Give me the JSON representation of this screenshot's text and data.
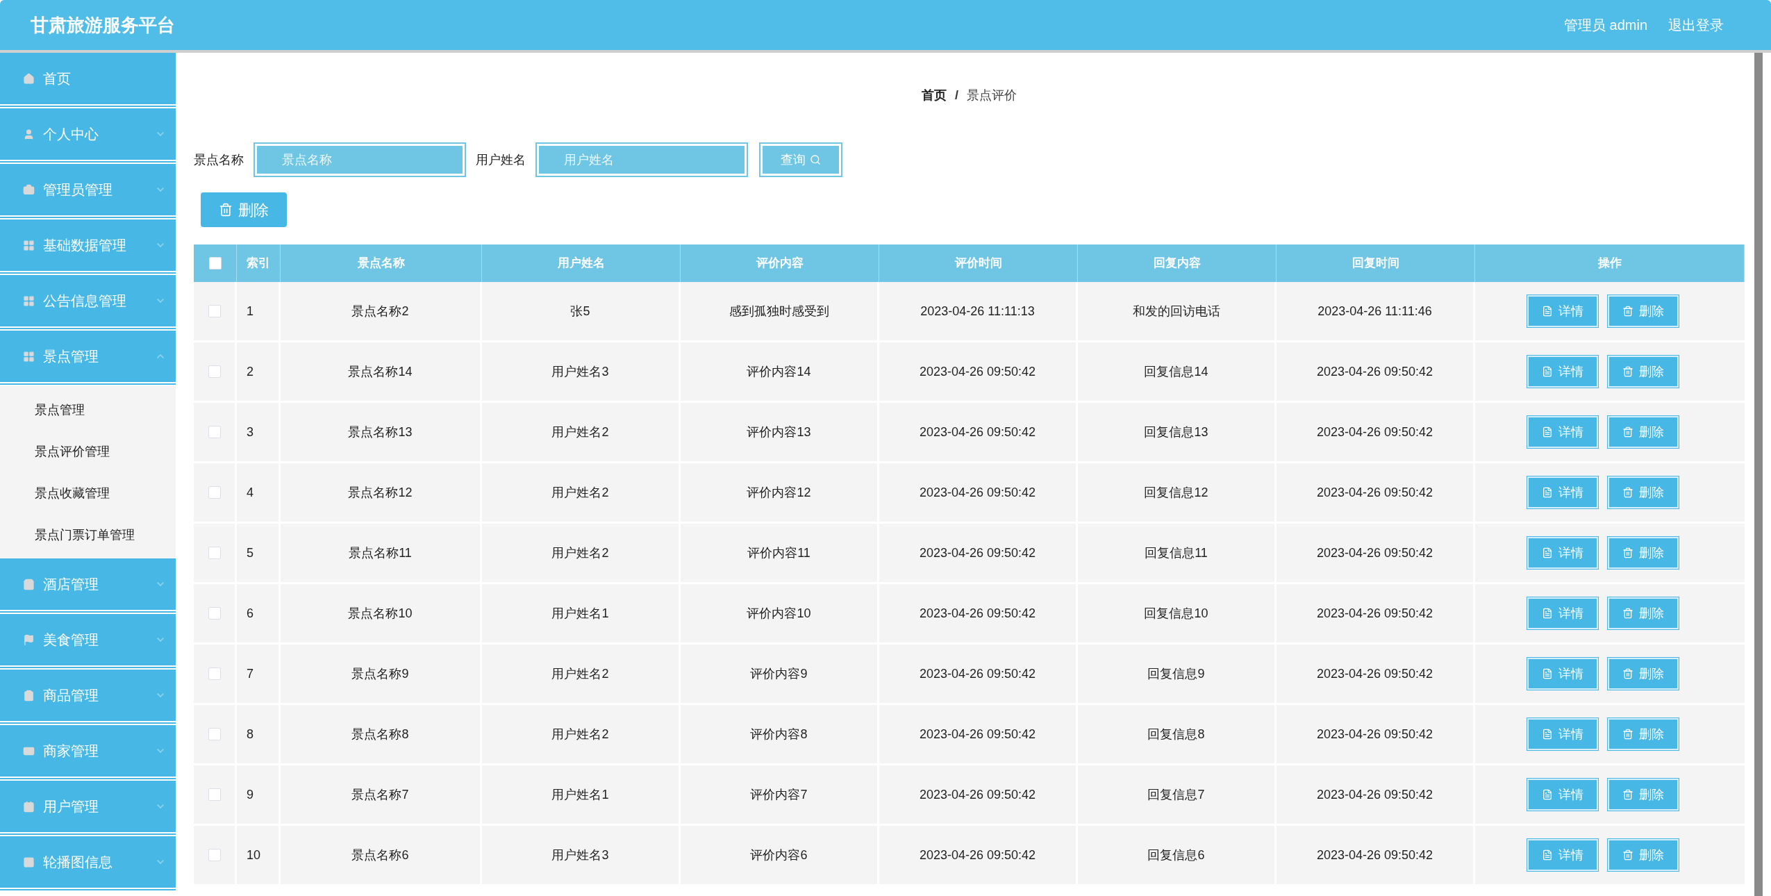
{
  "header": {
    "title": "甘肃旅游服务平台",
    "user": "管理员 admin",
    "logout": "退出登录"
  },
  "sidebar": {
    "items": [
      {
        "label": "首页",
        "kind": "link"
      },
      {
        "label": "个人中心",
        "kind": "menu",
        "expanded": false
      },
      {
        "label": "管理员管理",
        "kind": "menu",
        "expanded": false
      },
      {
        "label": "基础数据管理",
        "kind": "menu",
        "expanded": false
      },
      {
        "label": "公告信息管理",
        "kind": "menu",
        "expanded": false
      },
      {
        "label": "景点管理",
        "kind": "menu",
        "expanded": true,
        "children": [
          {
            "label": "景点管理"
          },
          {
            "label": "景点评价管理"
          },
          {
            "label": "景点收藏管理"
          },
          {
            "label": "景点门票订单管理"
          }
        ]
      },
      {
        "label": "酒店管理",
        "kind": "menu",
        "expanded": false
      },
      {
        "label": "美食管理",
        "kind": "menu",
        "expanded": false
      },
      {
        "label": "商品管理",
        "kind": "menu",
        "expanded": false
      },
      {
        "label": "商家管理",
        "kind": "menu",
        "expanded": false
      },
      {
        "label": "用户管理",
        "kind": "menu",
        "expanded": false
      },
      {
        "label": "轮播图信息",
        "kind": "menu",
        "expanded": false
      }
    ]
  },
  "breadcrumb": {
    "items": [
      "首页",
      "景点评价"
    ],
    "separator": "/"
  },
  "search": {
    "fields": [
      {
        "label": "景点名称",
        "placeholder": "景点名称"
      },
      {
        "label": "用户姓名",
        "placeholder": "用户姓名"
      }
    ],
    "button": "查询"
  },
  "bulk_delete": "删除",
  "table": {
    "all_checked": false,
    "columns": [
      "索引",
      "景点名称",
      "用户姓名",
      "评价内容",
      "评价时间",
      "回复内容",
      "回复时间",
      "操作"
    ],
    "rows": [
      {
        "checked": false,
        "cells": [
          "1",
          "景点名称2",
          "张5",
          "感到孤独时感受到",
          "2023-04-26 11:11:13",
          "和发的回访电话",
          "2023-04-26 11:11:46"
        ],
        "actions": [
          "详情",
          "删除"
        ]
      },
      {
        "checked": false,
        "cells": [
          "2",
          "景点名称14",
          "用户姓名3",
          "评价内容14",
          "2023-04-26 09:50:42",
          "回复信息14",
          "2023-04-26 09:50:42"
        ],
        "actions": [
          "详情",
          "删除"
        ]
      },
      {
        "checked": false,
        "cells": [
          "3",
          "景点名称13",
          "用户姓名2",
          "评价内容13",
          "2023-04-26 09:50:42",
          "回复信息13",
          "2023-04-26 09:50:42"
        ],
        "actions": [
          "详情",
          "删除"
        ]
      },
      {
        "checked": false,
        "cells": [
          "4",
          "景点名称12",
          "用户姓名2",
          "评价内容12",
          "2023-04-26 09:50:42",
          "回复信息12",
          "2023-04-26 09:50:42"
        ],
        "actions": [
          "详情",
          "删除"
        ]
      },
      {
        "checked": false,
        "cells": [
          "5",
          "景点名称11",
          "用户姓名2",
          "评价内容11",
          "2023-04-26 09:50:42",
          "回复信息11",
          "2023-04-26 09:50:42"
        ],
        "actions": [
          "详情",
          "删除"
        ]
      },
      {
        "checked": false,
        "cells": [
          "6",
          "景点名称10",
          "用户姓名1",
          "评价内容10",
          "2023-04-26 09:50:42",
          "回复信息10",
          "2023-04-26 09:50:42"
        ],
        "actions": [
          "详情",
          "删除"
        ]
      },
      {
        "checked": false,
        "cells": [
          "7",
          "景点名称9",
          "用户姓名2",
          "评价内容9",
          "2023-04-26 09:50:42",
          "回复信息9",
          "2023-04-26 09:50:42"
        ],
        "actions": [
          "详情",
          "删除"
        ]
      },
      {
        "checked": false,
        "cells": [
          "8",
          "景点名称8",
          "用户姓名2",
          "评价内容8",
          "2023-04-26 09:50:42",
          "回复信息8",
          "2023-04-26 09:50:42"
        ],
        "actions": [
          "详情",
          "删除"
        ]
      },
      {
        "checked": false,
        "cells": [
          "9",
          "景点名称7",
          "用户姓名1",
          "评价内容7",
          "2023-04-26 09:50:42",
          "回复信息7",
          "2023-04-26 09:50:42"
        ],
        "actions": [
          "详情",
          "删除"
        ]
      },
      {
        "checked": false,
        "cells": [
          "10",
          "景点名称6",
          "用户姓名3",
          "评价内容6",
          "2023-04-26 09:50:42",
          "回复信息6",
          "2023-04-26 09:50:42"
        ],
        "actions": [
          "详情",
          "删除"
        ]
      }
    ]
  }
}
